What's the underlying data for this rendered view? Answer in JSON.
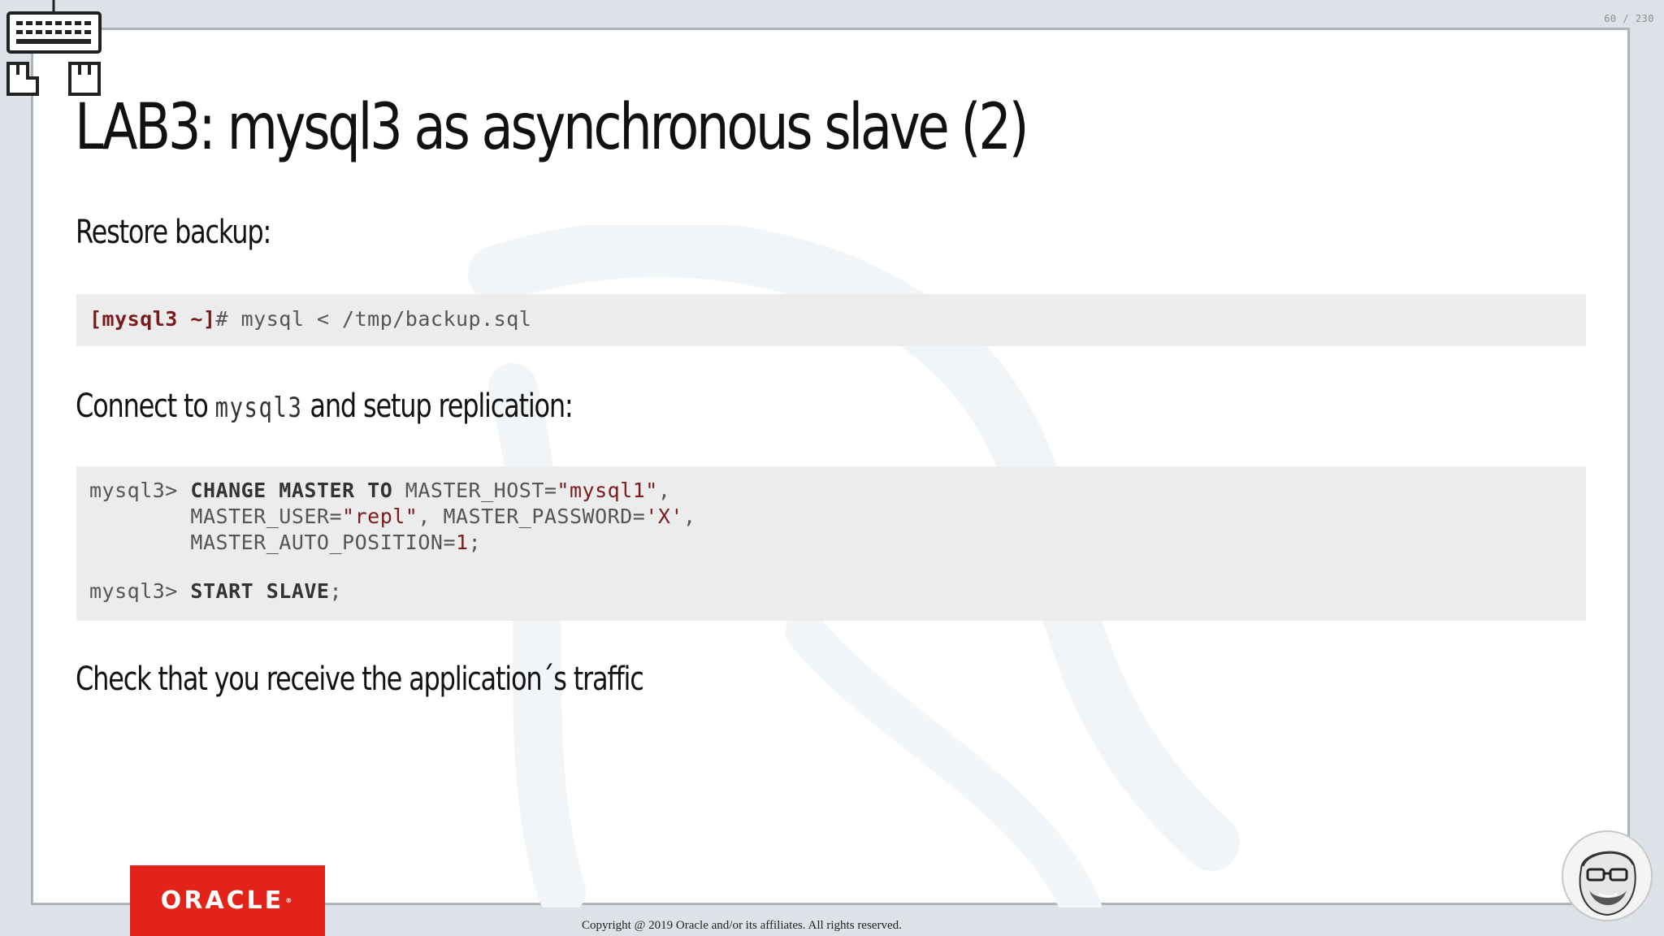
{
  "slide_counter": "60 / 230",
  "title": "LAB3: mysql3 as asynchronous slave (2)",
  "section_restore": {
    "heading": "Restore backup:",
    "code": {
      "prompt_host": "[mysql3 ~]",
      "prompt_symbol": "#",
      "command": " mysql < /tmp/backup.sql"
    }
  },
  "section_connect": {
    "heading_before": "Connect to ",
    "heading_code": "mysql3",
    "heading_after": " and setup replication:",
    "code": {
      "prompt": "mysql3> ",
      "kw_change_master_to": "CHANGE MASTER TO",
      "host_param": " MASTER_HOST=",
      "host_value": "\"mysql1\"",
      "comma": ",",
      "indent": "        ",
      "user_param": "MASTER_USER=",
      "user_value": "\"repl\"",
      "password_param": ", MASTER_PASSWORD=",
      "password_value": "'X'",
      "auto_pos_param": "MASTER_AUTO_POSITION=",
      "auto_pos_value": "1",
      "semicolon": ";",
      "prompt2": "mysql3> ",
      "kw_start_slave": "START SLAVE"
    }
  },
  "section_check": {
    "heading": "Check that you receive the application´s traffic"
  },
  "footer": {
    "logo_text": "ORACLE",
    "logo_mark": "®",
    "copyright": "Copyright @ 2019 Oracle and/or its affiliates. All rights reserved."
  },
  "icons": {
    "keyboard_icon": "keyboard-icon",
    "avatar": "presenter-avatar"
  },
  "colors": {
    "oracle_red": "#e2231a",
    "code_accent": "#7a1a1a",
    "code_background": "#ececec"
  }
}
